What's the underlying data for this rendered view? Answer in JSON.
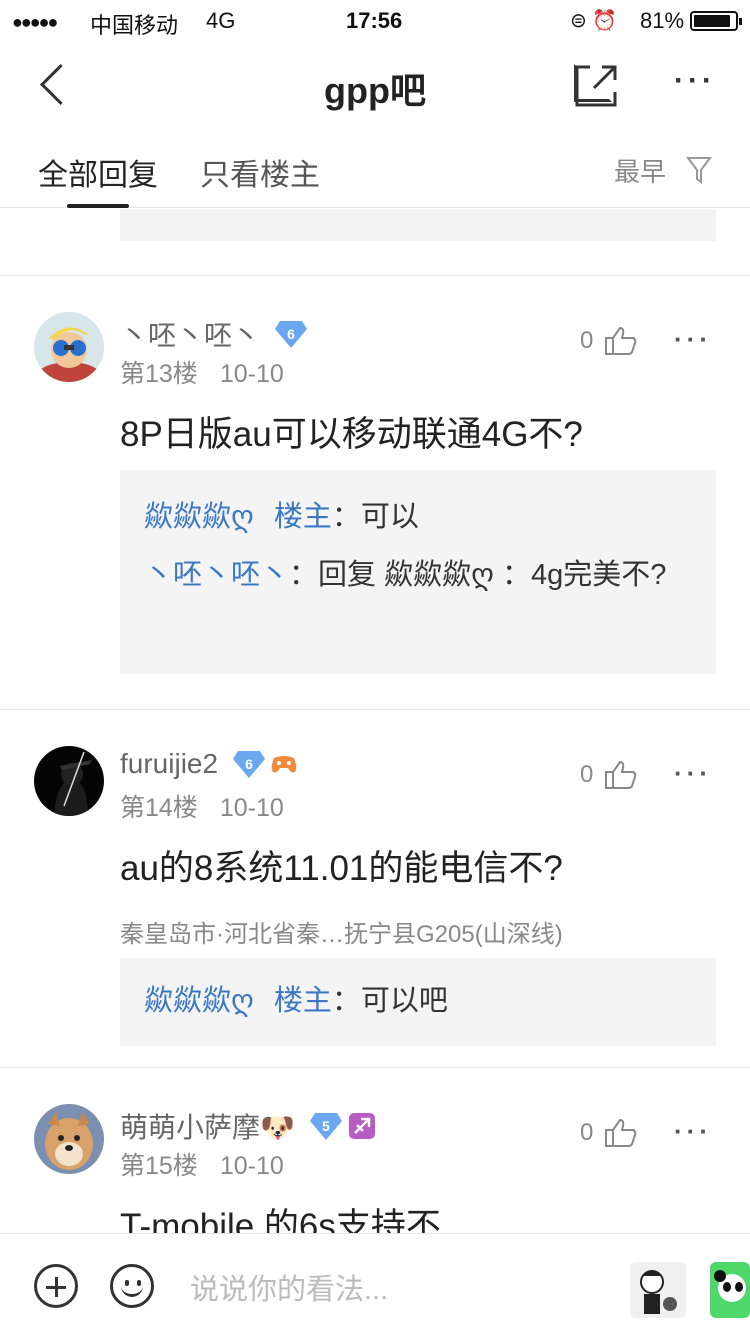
{
  "status_bar": {
    "signal": "●●●●●",
    "carrier": "中国移动",
    "network": "4G",
    "time": "17:56",
    "icons": "⊜ ⏰",
    "battery": "81%"
  },
  "nav": {
    "title": "gpp吧",
    "more": "···"
  },
  "tabs": {
    "all": "全部回复",
    "op_only": "只看楼主",
    "sort": "最早"
  },
  "posts": [
    {
      "username": "丶呸丶呸丶",
      "level": "6",
      "floor": "第13楼",
      "date": "10-10",
      "likes": "0",
      "more": "···",
      "text": "8P日版au可以移动联通4G不?",
      "replies": [
        {
          "name": "歘歘歘ღ",
          "host": "楼主",
          "sep": "：",
          "text": "可以"
        },
        {
          "name": "丶呸丶呸丶",
          "sep": "：",
          "text": "回复 歘歘歘ღ ：4g完美不?"
        }
      ]
    },
    {
      "username": "furuijie2",
      "level": "6",
      "floor": "第14楼",
      "date": "10-10",
      "likes": "0",
      "more": "···",
      "text": "au的8系统11.01的能电信不?",
      "location": "秦皇岛市·河北省秦…抚宁县G205(山深线)",
      "replies": [
        {
          "name": "歘歘歘ღ",
          "host": "楼主",
          "sep": "：",
          "text": "可以吧"
        }
      ]
    },
    {
      "username": "萌萌小萨摩🐶",
      "level": "5",
      "floor": "第15楼",
      "date": "10-10",
      "likes": "0",
      "more": "···",
      "text": "T-mobile 的6s支持不"
    }
  ],
  "bottom": {
    "placeholder": "说说你的看法..."
  },
  "colors": {
    "link_blue": "#3a78c4",
    "reply_bg": "#f4f4f4",
    "badge_blue": "#6aa7ef"
  }
}
